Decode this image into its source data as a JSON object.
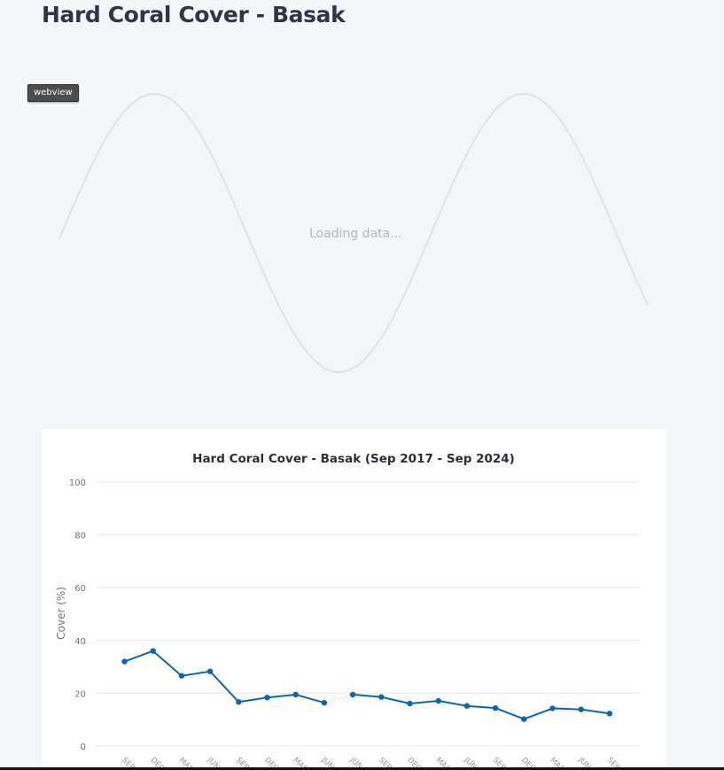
{
  "page": {
    "title": "Hard Coral Cover - Basak",
    "webview_badge": "webview",
    "loading_text": "Loading data..."
  },
  "colors": {
    "series": "#0a68a8",
    "grid": "#e6e6e6",
    "loader_wave": "#e0e0e0",
    "background": "#f3f7fa"
  },
  "chart_data": {
    "type": "line",
    "title": "Hard Coral Cover - Basak (Sep 2017 - Sep 2024)",
    "ylabel": "Cover (%)",
    "xlabel": "",
    "ylim": [
      0,
      100
    ],
    "yticks": [
      0,
      20,
      40,
      60,
      80,
      100
    ],
    "grid": true,
    "categories": [
      "SEP",
      "DEC",
      "MAR",
      "JUN",
      "SEP",
      "DEC",
      "MAR",
      "JUN",
      "JUN",
      "SEP",
      "DEC",
      "MAR",
      "JUN",
      "SEP",
      "DEC",
      "MAR",
      "JUN",
      "SEP"
    ],
    "series": [
      {
        "values": [
          32,
          36,
          26.6,
          28.3,
          16.7,
          18.4,
          19.5,
          16.4,
          19.5,
          18.6,
          16.1,
          17.1,
          15.2,
          14.4,
          10.2,
          14.3,
          13.9,
          12.3
        ],
        "gap_after_index": 7
      }
    ]
  }
}
